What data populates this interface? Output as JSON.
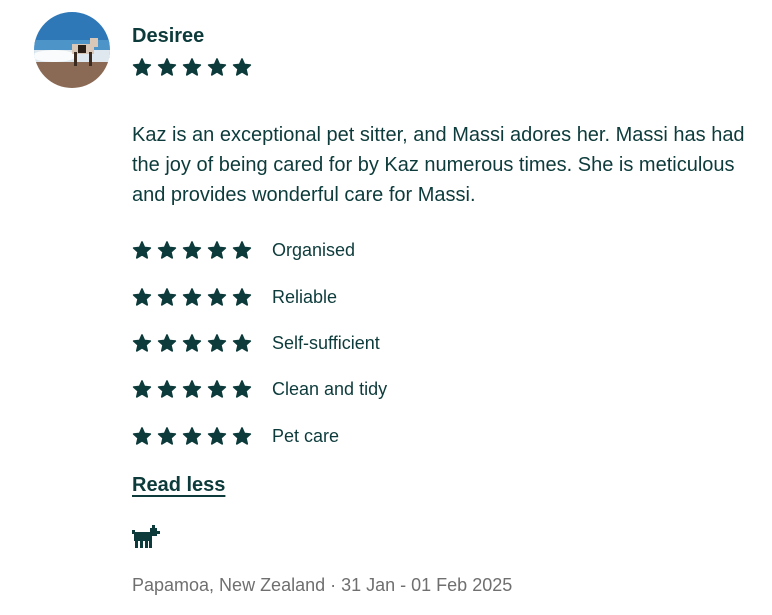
{
  "reviewer": {
    "name": "Desiree",
    "avatar": "avatar-photo-dog-on-beach",
    "overall_rating": 5
  },
  "review": {
    "text": "Kaz is an exceptional pet sitter, and Massi adores her. Massi has had the joy of being cared for by Kaz numerous times. She is meticulous and provides wonderful care for Massi."
  },
  "ratings": [
    {
      "label": "Organised",
      "stars": 5
    },
    {
      "label": "Reliable",
      "stars": 5
    },
    {
      "label": "Self-sufficient",
      "stars": 5
    },
    {
      "label": "Clean and tidy",
      "stars": 5
    },
    {
      "label": "Pet care",
      "stars": 5
    }
  ],
  "actions": {
    "read_less": "Read less"
  },
  "pet_icon": "dog-icon",
  "meta": {
    "text": "Papamoa, New Zealand · 31 Jan - 01 Feb 2025"
  },
  "colors": {
    "primary": "#0d3b3b",
    "muted": "#6f6f6f"
  }
}
